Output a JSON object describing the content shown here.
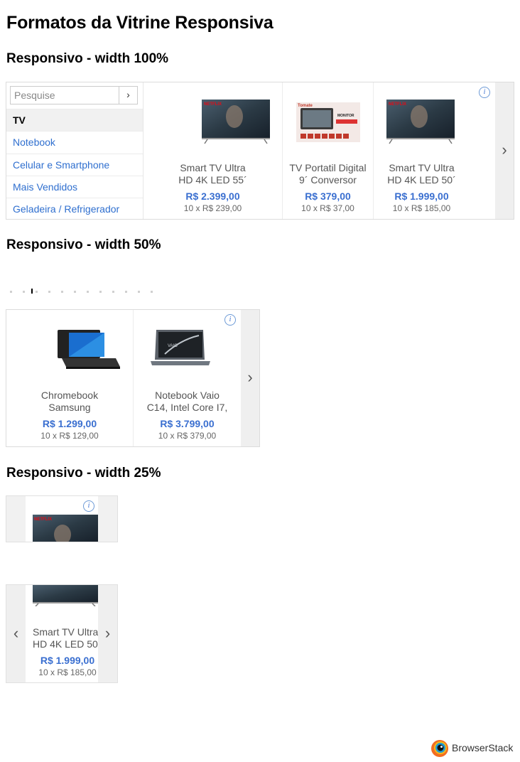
{
  "page": {
    "title": "Formatos da Vitrine Responsiva"
  },
  "sections": {
    "s100": "Responsivo - width 100%",
    "s50": "Responsivo - width 50%",
    "s25": "Responsivo - width 25%"
  },
  "widget100": {
    "search_placeholder": "Pesquise",
    "search_button": "›",
    "categories": [
      {
        "label": "TV"
      },
      {
        "label": "Notebook"
      },
      {
        "label": "Celular e Smartphone"
      },
      {
        "label": "Mais Vendidos"
      },
      {
        "label": "Geladeira / Refrigerador"
      }
    ],
    "products": [
      {
        "line1": "Smart TV Ultra",
        "line2": "HD 4K LED 55´",
        "price": "R$ 2.399,00",
        "installments": "10 x R$ 239,00"
      },
      {
        "line1": "TV Portatil Digital",
        "line2": "9´ Conversor",
        "price": "R$ 379,00",
        "installments": "10 x R$ 37,00"
      },
      {
        "line1": "Smart TV Ultra",
        "line2": "HD 4K LED 50´",
        "price": "R$ 1.999,00",
        "installments": "10 x R$ 185,00"
      }
    ],
    "next_arrow": "›",
    "info_icon": "i",
    "tv_brand": "NETFLIX",
    "portable_brand": "Tomate",
    "portable_label": "MONITOR"
  },
  "widget50": {
    "products": [
      {
        "line1": "Chromebook",
        "line2": "Samsung",
        "price": "R$ 1.299,00",
        "installments": "10 x R$ 129,00"
      },
      {
        "line1": "Notebook Vaio",
        "line2": "C14, Intel Core I7,",
        "price": "R$ 3.799,00",
        "installments": "10 x R$ 379,00"
      }
    ],
    "next_arrow": "›",
    "info_icon": "i",
    "notebook_brand": "VAIO"
  },
  "widget25": {
    "top": {
      "info_icon": "i",
      "tv_brand": "NETFLIX"
    },
    "bottom": {
      "line1": "Smart TV Ultra",
      "line2": "HD 4K LED 50",
      "price": "R$ 1.999,00",
      "installments": "10 x R$ 185,00",
      "prev_arrow": "‹",
      "next_arrow": "›"
    }
  },
  "footer": {
    "brand": "BrowserStack"
  },
  "colors": {
    "price": "#3a6fd0",
    "link": "#2f6fcf"
  }
}
